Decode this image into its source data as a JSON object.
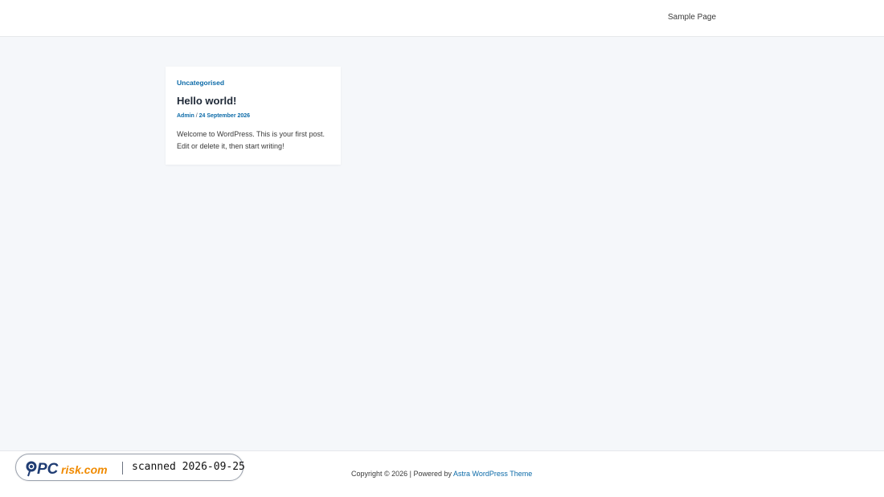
{
  "header": {
    "nav": {
      "sample_page": "Sample Page"
    }
  },
  "post": {
    "category": "Uncategorised",
    "title": "Hello world!",
    "author": "Admin",
    "separator": "/",
    "date": "24 September 2026",
    "excerpt": "Welcome to WordPress. This is your first post. Edit or delete it, then start writing!"
  },
  "footer": {
    "copyright": "Copyright © 2026 | Powered by ",
    "theme_link": "Astra WordPress Theme"
  },
  "watermark": {
    "logo_text": "PCrisk.com",
    "scan_text": "scanned 2026-09-25"
  },
  "colors": {
    "accent": "#0b6aa8",
    "page_bg": "#f5f7fa",
    "logo_orange": "#f08a00",
    "logo_navy": "#1f3c73"
  }
}
